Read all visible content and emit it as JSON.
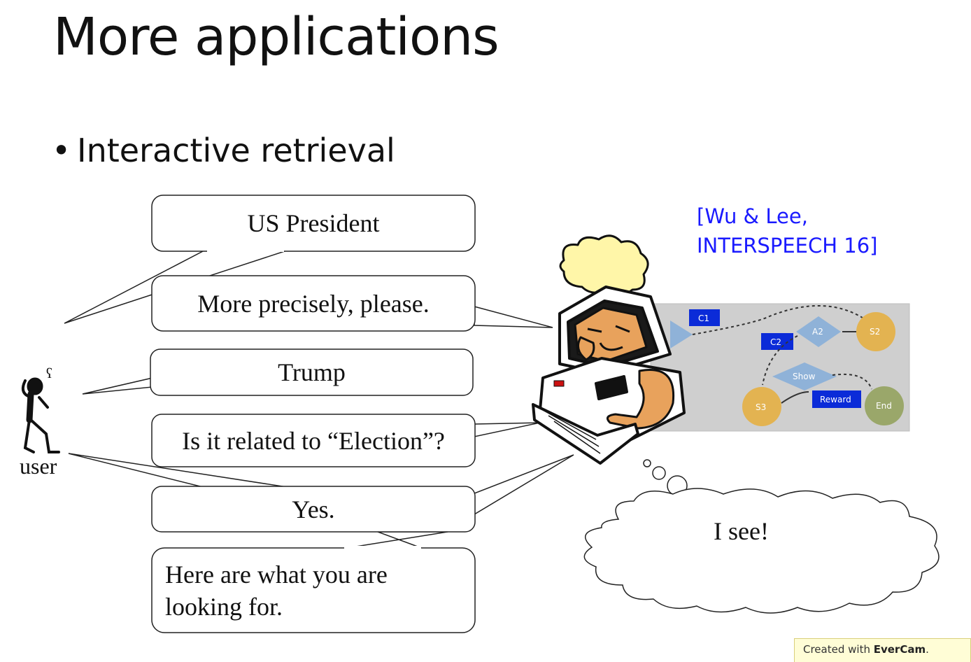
{
  "slide": {
    "title": "More applications",
    "bullet": "Interactive retrieval",
    "citation_line1": "[Wu & Lee,",
    "citation_line2": "INTERSPEECH 16]"
  },
  "dialog": {
    "bubbles": [
      "US President",
      "More precisely, please.",
      "Trump",
      "Is it related to “Election”?",
      "Yes.",
      "Here are what you are looking for."
    ],
    "user_label": "user",
    "thought": "I see!"
  },
  "diagram": {
    "labels": {
      "c1": "C1",
      "c2": "C2",
      "a2": "A2",
      "s2": "S2",
      "show": "Show",
      "s3": "S3",
      "reward": "Reward",
      "end": "End"
    },
    "colors": {
      "blue_box": "#0b2bd8",
      "diamond": "#8fb2d8",
      "state_circle": "#e3b351",
      "end_circle": "#9aa76a",
      "panel": "#cfcfcf"
    }
  },
  "watermark": {
    "prefix": "Created with ",
    "brand": "EverCam",
    "suffix": "."
  },
  "colors": {
    "citation": "#1a1aff",
    "watermark_bg": "#fffdd6"
  }
}
